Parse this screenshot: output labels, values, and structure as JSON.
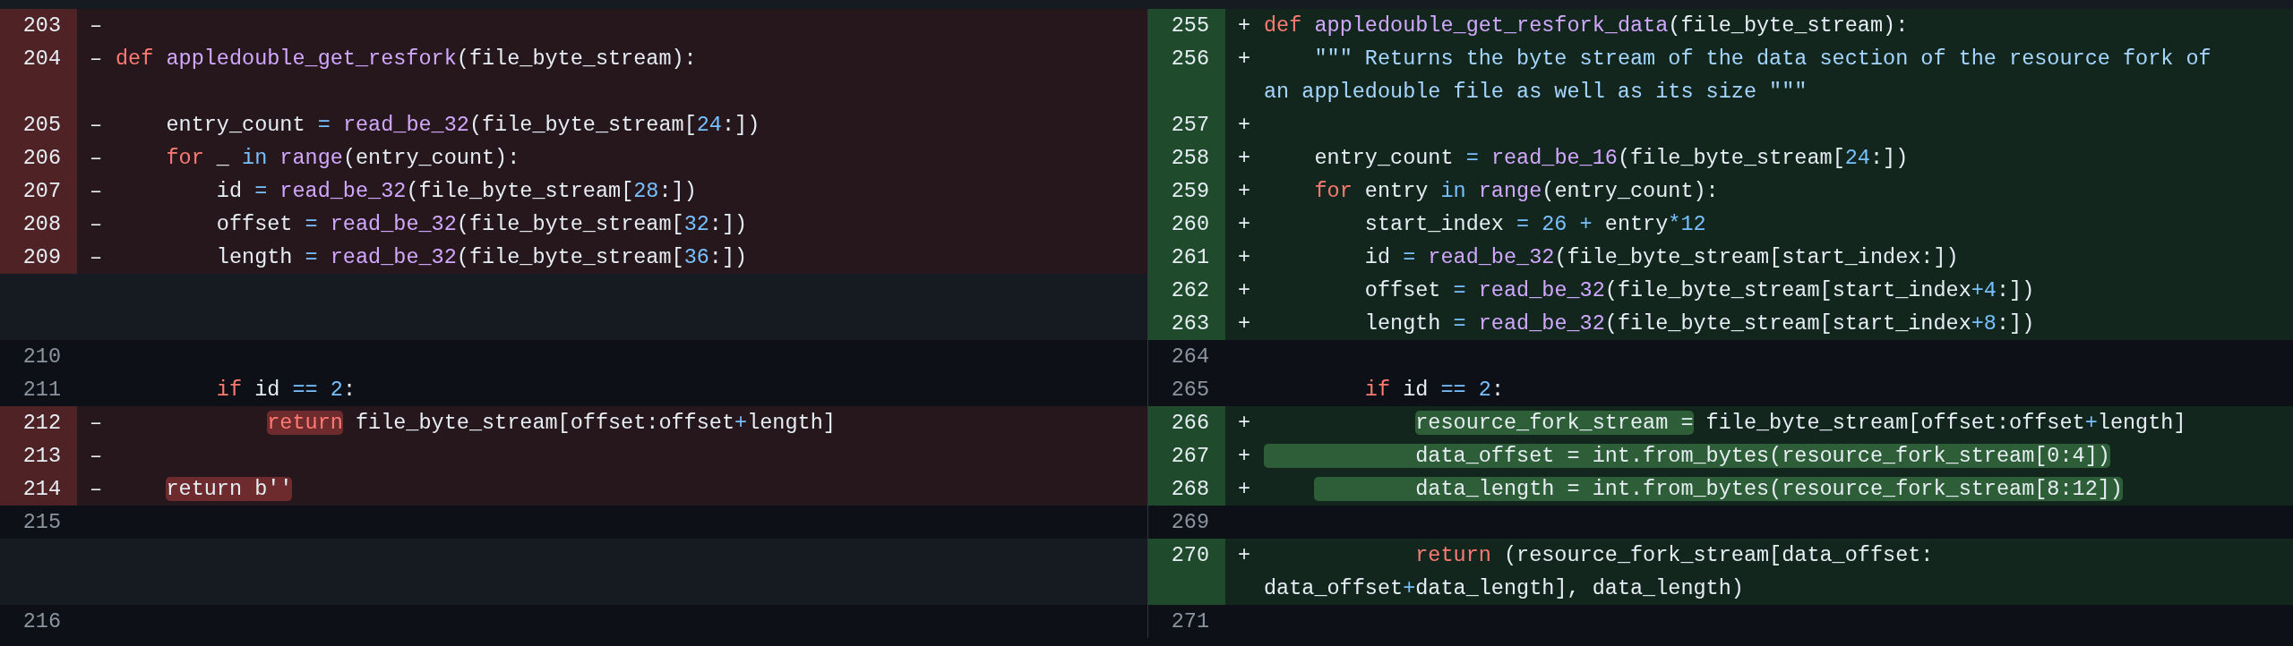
{
  "diff": {
    "rows": [
      {
        "left": {
          "kind": "deleted",
          "number": "203",
          "sign": "–"
        },
        "right": {
          "kind": "added",
          "number": "255",
          "sign": "+",
          "code": [
            {
              "kind": "keyword",
              "text": "def "
            },
            {
              "kind": "function",
              "text": "appledouble_get_resfork_data"
            },
            {
              "kind": "plain",
              "text": "(file_byte_stream):"
            }
          ]
        }
      },
      {
        "left": {
          "kind": "deleted",
          "number": "204",
          "sign": "–",
          "code": [
            {
              "kind": "keyword",
              "text": "def "
            },
            {
              "kind": "function",
              "text": "appledouble_get_resfork"
            },
            {
              "kind": "plain",
              "text": "(file_byte_stream):"
            }
          ]
        },
        "right": {
          "kind": "added",
          "number": "256",
          "sign": "+",
          "code": [
            {
              "kind": "string",
              "text": "    \"\"\" Returns the byte stream of the data section of the resource fork of an appledouble file as well as its size \"\"\""
            }
          ]
        }
      },
      {
        "left": {
          "kind": "deleted",
          "number": "205",
          "sign": "–",
          "code": [
            {
              "kind": "plain",
              "text": "    entry_count "
            },
            {
              "kind": "operator",
              "text": "= "
            },
            {
              "kind": "function",
              "text": "read_be_32"
            },
            {
              "kind": "plain",
              "text": "(file_byte_stream["
            },
            {
              "kind": "operator",
              "text": "24"
            },
            {
              "kind": "plain",
              "text": ":])"
            }
          ]
        },
        "right": {
          "kind": "added",
          "number": "257",
          "sign": "+"
        }
      },
      {
        "left": {
          "kind": "deleted",
          "number": "206",
          "sign": "–",
          "code": [
            {
              "kind": "keyword",
              "text": "    for"
            },
            {
              "kind": "plain",
              "text": " _ "
            },
            {
              "kind": "operator",
              "text": "in "
            },
            {
              "kind": "function",
              "text": "range"
            },
            {
              "kind": "plain",
              "text": "(entry_count):"
            }
          ]
        },
        "right": {
          "kind": "added",
          "number": "258",
          "sign": "+",
          "code": [
            {
              "kind": "plain",
              "text": "    entry_count "
            },
            {
              "kind": "operator",
              "text": "= "
            },
            {
              "kind": "function",
              "text": "read_be_16"
            },
            {
              "kind": "plain",
              "text": "(file_byte_stream["
            },
            {
              "kind": "operator",
              "text": "24"
            },
            {
              "kind": "plain",
              "text": ":])"
            }
          ]
        }
      },
      {
        "left": {
          "kind": "deleted",
          "number": "207",
          "sign": "–",
          "code": [
            {
              "kind": "plain",
              "text": "        id "
            },
            {
              "kind": "operator",
              "text": "= "
            },
            {
              "kind": "function",
              "text": "read_be_32"
            },
            {
              "kind": "plain",
              "text": "(file_byte_stream["
            },
            {
              "kind": "operator",
              "text": "28"
            },
            {
              "kind": "plain",
              "text": ":])"
            }
          ]
        },
        "right": {
          "kind": "added",
          "number": "259",
          "sign": "+",
          "code": [
            {
              "kind": "keyword",
              "text": "    for"
            },
            {
              "kind": "plain",
              "text": " entry "
            },
            {
              "kind": "operator",
              "text": "in "
            },
            {
              "kind": "function",
              "text": "range"
            },
            {
              "kind": "plain",
              "text": "(entry_count):"
            }
          ]
        }
      },
      {
        "left": {
          "kind": "deleted",
          "number": "208",
          "sign": "–",
          "code": [
            {
              "kind": "plain",
              "text": "        offset "
            },
            {
              "kind": "operator",
              "text": "= "
            },
            {
              "kind": "function",
              "text": "read_be_32"
            },
            {
              "kind": "plain",
              "text": "(file_byte_stream["
            },
            {
              "kind": "operator",
              "text": "32"
            },
            {
              "kind": "plain",
              "text": ":])"
            }
          ]
        },
        "right": {
          "kind": "added",
          "number": "260",
          "sign": "+",
          "code": [
            {
              "kind": "plain",
              "text": "        start_index "
            },
            {
              "kind": "operator",
              "text": "= 26 + "
            },
            {
              "kind": "plain",
              "text": "entry"
            },
            {
              "kind": "operator",
              "text": "*12"
            }
          ]
        }
      },
      {
        "left": {
          "kind": "deleted",
          "number": "209",
          "sign": "–",
          "code": [
            {
              "kind": "plain",
              "text": "        length "
            },
            {
              "kind": "operator",
              "text": "= "
            },
            {
              "kind": "function",
              "text": "read_be_32"
            },
            {
              "kind": "plain",
              "text": "(file_byte_stream["
            },
            {
              "kind": "operator",
              "text": "36"
            },
            {
              "kind": "plain",
              "text": ":])"
            }
          ]
        },
        "right": {
          "kind": "added",
          "number": "261",
          "sign": "+",
          "code": [
            {
              "kind": "plain",
              "text": "        id "
            },
            {
              "kind": "operator",
              "text": "= "
            },
            {
              "kind": "function",
              "text": "read_be_32"
            },
            {
              "kind": "plain",
              "text": "(file_byte_stream[start_index:])"
            }
          ]
        }
      },
      {
        "right": {
          "kind": "added",
          "number": "262",
          "sign": "+",
          "code": [
            {
              "kind": "plain",
              "text": "        offset "
            },
            {
              "kind": "operator",
              "text": "= "
            },
            {
              "kind": "function",
              "text": "read_be_32"
            },
            {
              "kind": "plain",
              "text": "(file_byte_stream[start_index"
            },
            {
              "kind": "operator",
              "text": "+4"
            },
            {
              "kind": "plain",
              "text": ":])"
            }
          ]
        }
      },
      {
        "right": {
          "kind": "added",
          "number": "263",
          "sign": "+",
          "code": [
            {
              "kind": "plain",
              "text": "        length "
            },
            {
              "kind": "operator",
              "text": "= "
            },
            {
              "kind": "function",
              "text": "read_be_32"
            },
            {
              "kind": "plain",
              "text": "(file_byte_stream[start_index"
            },
            {
              "kind": "operator",
              "text": "+8"
            },
            {
              "kind": "plain",
              "text": ":])"
            }
          ]
        }
      },
      {
        "left": {
          "kind": "context",
          "number": "210"
        },
        "right": {
          "kind": "context",
          "number": "264"
        }
      },
      {
        "left": {
          "kind": "context",
          "number": "211",
          "code": [
            {
              "kind": "keyword",
              "text": "        if"
            },
            {
              "kind": "plain",
              "text": " id "
            },
            {
              "kind": "operator",
              "text": "== 2"
            },
            {
              "kind": "plain",
              "text": ":"
            }
          ]
        },
        "right": {
          "kind": "context",
          "number": "265",
          "code": [
            {
              "kind": "keyword",
              "text": "        if"
            },
            {
              "kind": "plain",
              "text": " id "
            },
            {
              "kind": "operator",
              "text": "== 2"
            },
            {
              "kind": "plain",
              "text": ":"
            }
          ]
        }
      },
      {
        "left": {
          "kind": "deleted",
          "number": "212",
          "sign": "–",
          "code": [
            {
              "kind": "marked-keyword",
              "text": "            return"
            },
            {
              "kind": "plain",
              "text": " file_byte_stream[offset:offset"
            },
            {
              "kind": "operator",
              "text": "+"
            },
            {
              "kind": "plain",
              "text": "length]"
            }
          ]
        },
        "right": {
          "kind": "added",
          "number": "266",
          "sign": "+",
          "code": [
            {
              "kind": "marked-word",
              "text": "            resource_fork_stream ="
            },
            {
              "kind": "plain",
              "text": " file_byte_stream[offset:offset"
            },
            {
              "kind": "operator",
              "text": "+"
            },
            {
              "kind": "plain",
              "text": "length]"
            }
          ]
        }
      },
      {
        "left": {
          "kind": "deleted",
          "number": "213",
          "sign": "–"
        },
        "right": {
          "kind": "added",
          "number": "267",
          "sign": "+",
          "code": [
            {
              "kind": "marked",
              "text": "            data_offset = int.from_bytes(resource_fork_stream[0:4])"
            }
          ]
        }
      },
      {
        "left": {
          "kind": "deleted",
          "number": "214",
          "sign": "–",
          "code": [
            {
              "kind": "marked-word",
              "text": "    return b''"
            }
          ]
        },
        "right": {
          "kind": "added",
          "number": "268",
          "sign": "+",
          "code": [
            {
              "kind": "marked-after-indent",
              "text": "            data_length = int.from_bytes(resource_fork_stream[8:12])"
            }
          ]
        }
      },
      {
        "left": {
          "kind": "context",
          "number": "215"
        },
        "right": {
          "kind": "context",
          "number": "269"
        }
      },
      {
        "right": {
          "kind": "added",
          "number": "270",
          "sign": "+",
          "code": [
            {
              "kind": "keyword",
              "text": "            return"
            },
            {
              "kind": "plain",
              "text": " (resource_fork_stream[data_offset: data_offset"
            },
            {
              "kind": "operator",
              "text": "+"
            },
            {
              "kind": "plain",
              "text": "data_length], data_length)"
            }
          ]
        }
      },
      {
        "left": {
          "kind": "context",
          "number": "216"
        },
        "right": {
          "kind": "context",
          "number": "271"
        }
      }
    ]
  }
}
